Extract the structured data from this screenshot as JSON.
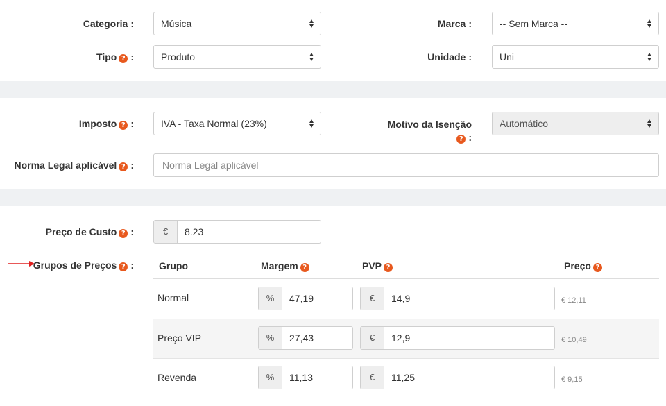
{
  "section1": {
    "categoria_label": "Categoria",
    "categoria_value": "Música",
    "marca_label": "Marca",
    "marca_value": "-- Sem Marca --",
    "tipo_label": "Tipo",
    "tipo_value": "Produto",
    "unidade_label": "Unidade",
    "unidade_value": "Uni"
  },
  "section2": {
    "imposto_label": "Imposto",
    "imposto_value": "IVA - Taxa Normal (23%)",
    "motivo_label": "Motivo da Isenção",
    "motivo_value": "Automático",
    "norma_label": "Norma Legal aplicável",
    "norma_placeholder": "Norma Legal aplicável"
  },
  "section3": {
    "custo_label": "Preço de Custo",
    "custo_currency": "€",
    "custo_value": "8.23",
    "grupos_label": "Grupos de Preços",
    "columns": {
      "grupo": "Grupo",
      "margem": "Margem",
      "pvp": "PVP",
      "preco": "Preço"
    },
    "rows": [
      {
        "name": "Normal",
        "margin_symbol": "%",
        "margin": "47,19",
        "pvp_symbol": "€",
        "pvp": "14,9",
        "price": "€ 12,11"
      },
      {
        "name": "Preço VIP",
        "margin_symbol": "%",
        "margin": "27,43",
        "pvp_symbol": "€",
        "pvp": "12,9",
        "price": "€ 10,49"
      },
      {
        "name": "Revenda",
        "margin_symbol": "%",
        "margin": "11,13",
        "pvp_symbol": "€",
        "pvp": "11,25",
        "price": "€ 9,15"
      }
    ]
  },
  "icons": {
    "help": "question-circle-icon",
    "arrow": "red-arrow-icon",
    "select": "select-arrows-icon"
  },
  "colors": {
    "help_icon": "#e8591e",
    "arrow": "#e02020",
    "band": "#eff1f3",
    "row_alt": "#f5f5f5"
  }
}
